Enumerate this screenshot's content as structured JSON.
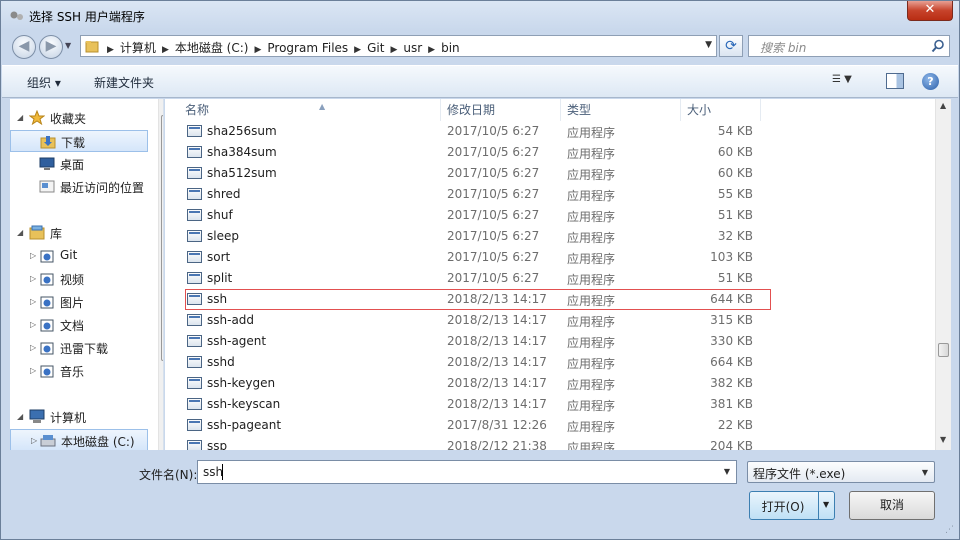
{
  "window": {
    "title": "选择 SSH 用户端程序",
    "close_label": "✕"
  },
  "address_bar": {
    "crumbs": [
      "计算机",
      "本地磁盘 (C:)",
      "Program Files",
      "Git",
      "usr",
      "bin"
    ]
  },
  "search": {
    "placeholder": "搜索 bin"
  },
  "toolbar": {
    "organize_label": "组织 ▾",
    "new_folder_label": "新建文件夹"
  },
  "nav": {
    "favorites": {
      "label": "收藏夹",
      "items": [
        "下载",
        "桌面",
        "最近访问的位置"
      ]
    },
    "libraries": {
      "label": "库",
      "items": [
        "Git",
        "视频",
        "图片",
        "文档",
        "迅雷下载",
        "音乐"
      ]
    },
    "computer": {
      "label": "计算机",
      "items": [
        "本地磁盘 (C:)"
      ]
    }
  },
  "columns": {
    "name": "名称",
    "date": "修改日期",
    "type": "类型",
    "size": "大小"
  },
  "files": [
    {
      "name": "sha256sum",
      "date": "2017/10/5 6:27",
      "type": "应用程序",
      "size": "54 KB"
    },
    {
      "name": "sha384sum",
      "date": "2017/10/5 6:27",
      "type": "应用程序",
      "size": "60 KB"
    },
    {
      "name": "sha512sum",
      "date": "2017/10/5 6:27",
      "type": "应用程序",
      "size": "60 KB"
    },
    {
      "name": "shred",
      "date": "2017/10/5 6:27",
      "type": "应用程序",
      "size": "55 KB"
    },
    {
      "name": "shuf",
      "date": "2017/10/5 6:27",
      "type": "应用程序",
      "size": "51 KB"
    },
    {
      "name": "sleep",
      "date": "2017/10/5 6:27",
      "type": "应用程序",
      "size": "32 KB"
    },
    {
      "name": "sort",
      "date": "2017/10/5 6:27",
      "type": "应用程序",
      "size": "103 KB"
    },
    {
      "name": "split",
      "date": "2017/10/5 6:27",
      "type": "应用程序",
      "size": "51 KB"
    },
    {
      "name": "ssh",
      "date": "2018/2/13 14:17",
      "type": "应用程序",
      "size": "644 KB"
    },
    {
      "name": "ssh-add",
      "date": "2018/2/13 14:17",
      "type": "应用程序",
      "size": "315 KB"
    },
    {
      "name": "ssh-agent",
      "date": "2018/2/13 14:17",
      "type": "应用程序",
      "size": "330 KB"
    },
    {
      "name": "sshd",
      "date": "2018/2/13 14:17",
      "type": "应用程序",
      "size": "664 KB"
    },
    {
      "name": "ssh-keygen",
      "date": "2018/2/13 14:17",
      "type": "应用程序",
      "size": "382 KB"
    },
    {
      "name": "ssh-keyscan",
      "date": "2018/2/13 14:17",
      "type": "应用程序",
      "size": "381 KB"
    },
    {
      "name": "ssh-pageant",
      "date": "2017/8/31 12:26",
      "type": "应用程序",
      "size": "22 KB"
    },
    {
      "name": "ssp",
      "date": "2018/2/12 21:38",
      "type": "应用程序",
      "size": "204 KB"
    }
  ],
  "highlighted_file": "ssh",
  "filename": {
    "label": "文件名(N):",
    "value": "ssh"
  },
  "file_type": {
    "selected": "程序文件 (*.exe)"
  },
  "buttons": {
    "open_label": "打开(O)",
    "cancel_label": "取消"
  },
  "colors": {
    "highlight_outline": "#e25050",
    "window_frame": "#c9d8ec"
  }
}
